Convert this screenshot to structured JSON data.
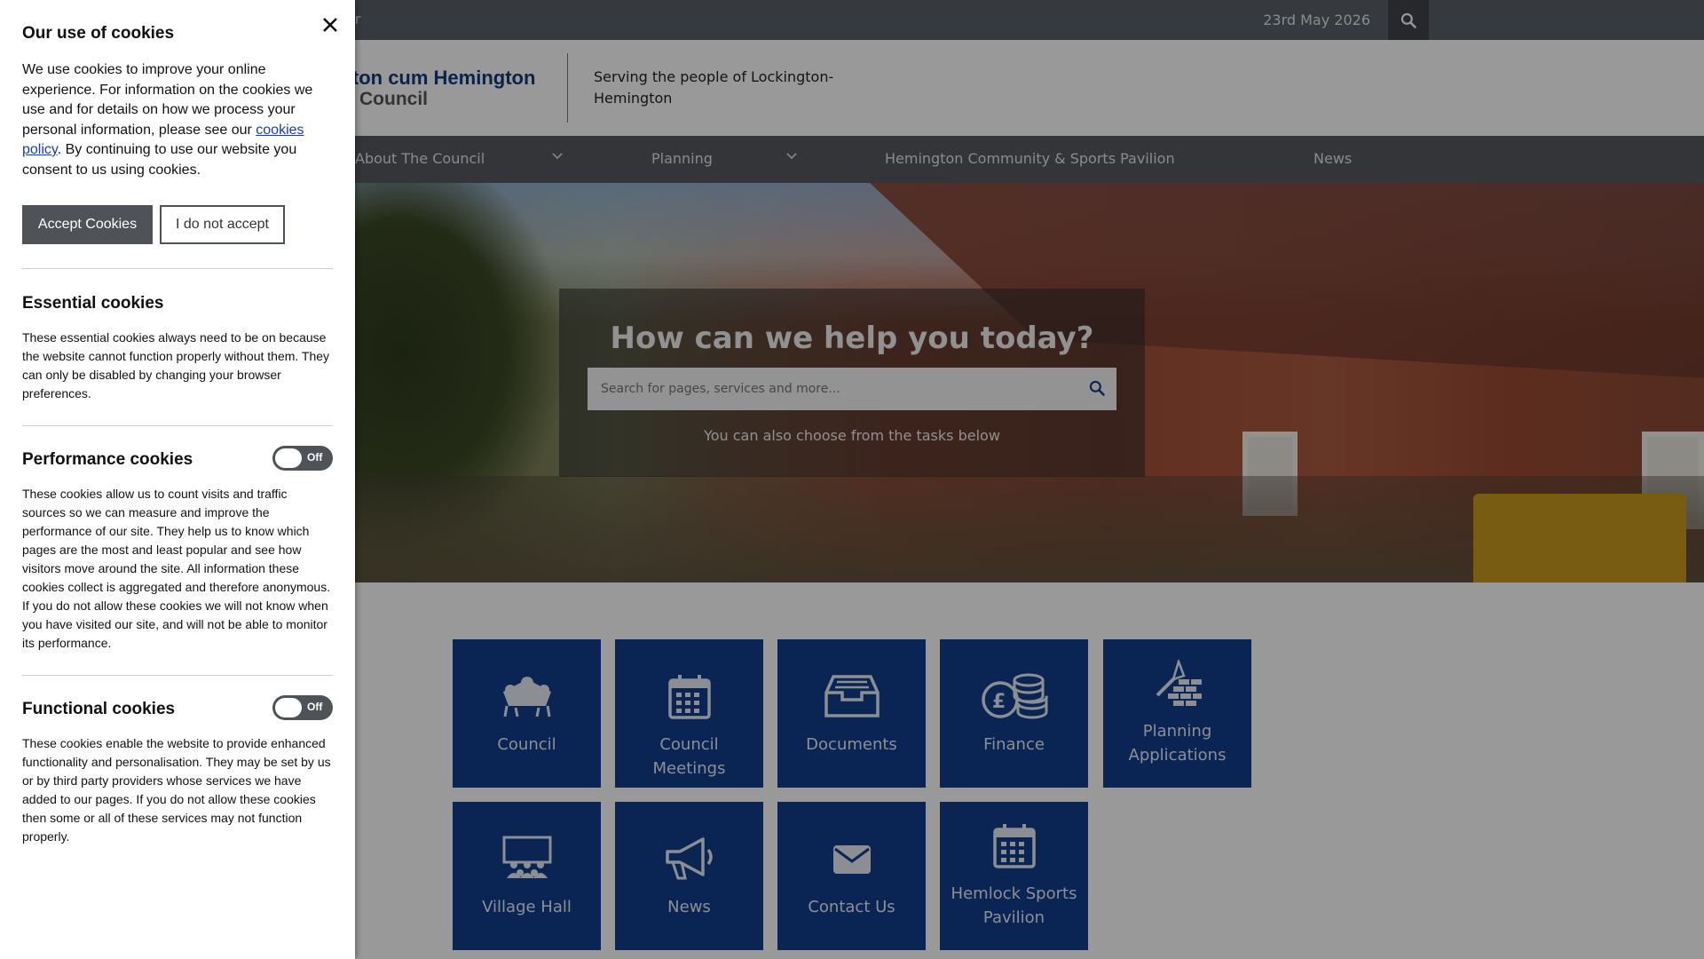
{
  "topbar": {
    "left_text": "er",
    "date": "23rd May 2026",
    "search_icon": "search-icon"
  },
  "header": {
    "logo_line1": "ngton cum Hemington",
    "logo_line2": "Council",
    "tagline": "Serving the people of Lockington-Hemington"
  },
  "nav": {
    "items": [
      {
        "label": "About The Council",
        "has_dropdown": true
      },
      {
        "label": "Planning",
        "has_dropdown": true
      },
      {
        "label": "Hemington Community & Sports Pavilion",
        "has_dropdown": false
      },
      {
        "label": "News",
        "has_dropdown": false
      }
    ]
  },
  "hero": {
    "title": "How can we help you today?",
    "search_placeholder": "Search for pages, services and more...",
    "subtitle": "You can also choose from the tasks below"
  },
  "tiles": [
    {
      "label": "Council",
      "icon": "council-icon"
    },
    {
      "label": "Council Meetings",
      "icon": "calendar-icon"
    },
    {
      "label": "Documents",
      "icon": "archive-box-icon"
    },
    {
      "label": "Finance",
      "icon": "coins-icon"
    },
    {
      "label": "Planning Applications",
      "icon": "trowel-bricks-icon"
    },
    {
      "label": "Village Hall",
      "icon": "village-hall-icon"
    },
    {
      "label": "News",
      "icon": "megaphone-icon"
    },
    {
      "label": "Contact Us",
      "icon": "envelope-icon"
    },
    {
      "label": "Hemlock Sports Pavilion",
      "icon": "calendar-icon"
    }
  ],
  "cookies": {
    "title": "Our use of cookies",
    "intro_before_link": "We use cookies to improve your online experience. For information on the cookies we use and for details on how we process your personal information, please see our ",
    "intro_link": "cookies policy",
    "intro_after_link": ". By continuing to use our website you consent to us using cookies.",
    "accept_label": "Accept Cookies",
    "decline_label": "I do not accept",
    "essential": {
      "title": "Essential cookies",
      "description": "These essential cookies always need to be on because the website cannot function properly without them. They can only be disabled by changing your browser preferences."
    },
    "performance": {
      "title": "Performance cookies",
      "toggle_state": "Off",
      "description": "These cookies allow us to count visits and traffic sources so we can measure and improve the performance of our site. They help us to know which pages are the most and least popular and see how visitors move around the site. All information these cookies collect is aggregated and therefore anonymous. If you do not allow these cookies we will not know when you have visited our site, and will not be able to monitor its performance."
    },
    "functional": {
      "title": "Functional cookies",
      "toggle_state": "Off",
      "description": "These cookies enable the website to provide enhanced functionality and personalisation. They may be set by us or by third party providers whose services we have added to our pages. If you do not allow these cookies then some or all of these services may not function properly."
    }
  }
}
